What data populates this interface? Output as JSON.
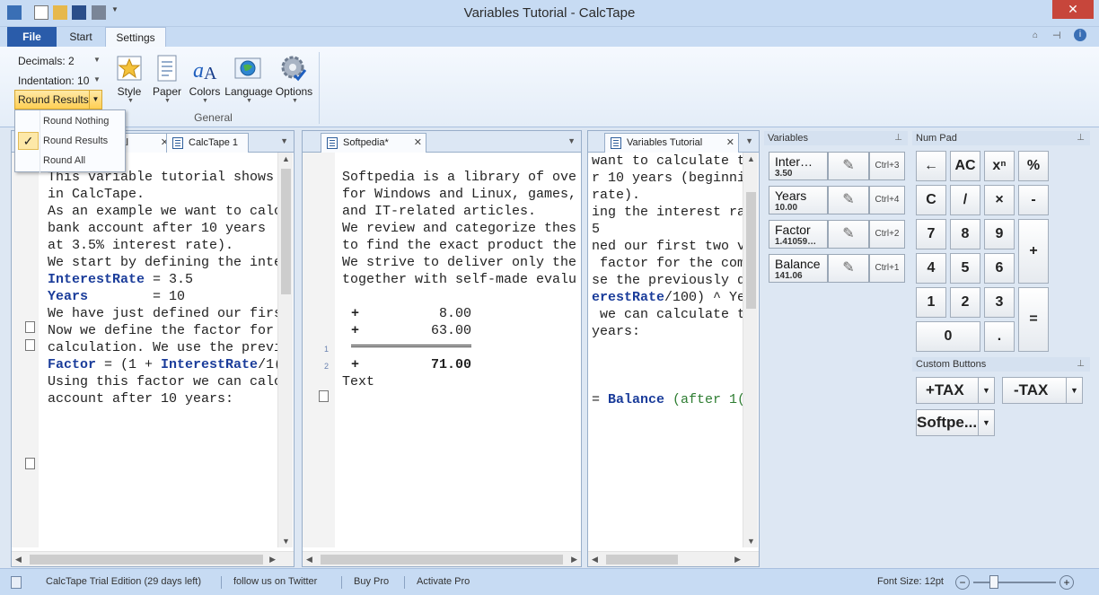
{
  "window": {
    "title": "Variables Tutorial - CalcTape",
    "close_glyph": "✕"
  },
  "ribbon": {
    "tabs": {
      "file": "File",
      "start": "Start",
      "settings": "Settings"
    },
    "decimals": "Decimals: 2",
    "indentation": "Indentation: 10",
    "round_button": "Round Results",
    "buttons": {
      "style": "Style",
      "paper": "Paper",
      "colors": "Colors",
      "language": "Language",
      "options": "Options"
    },
    "group_label": "General"
  },
  "round_menu": {
    "items": [
      "Round Nothing",
      "Round Results",
      "Round All"
    ],
    "checked": "Round Results",
    "check_glyph": "✓"
  },
  "pane1": {
    "tabs": [
      "ial",
      "CalcTape 1"
    ],
    "lines": [
      "This variable tutorial shows",
      "in CalcTape.",
      "",
      "As an example we want to calc",
      "bank account after 10 years",
      "at 3.5% interest rate).",
      "",
      "We start by defining the inte",
      "",
      "",
      "",
      "We have just defined our firs",
      "",
      "Now we define the factor for",
      "calculation. We use the previ",
      "",
      "",
      "",
      "Using this factor we can calc",
      "account after 10 years:"
    ],
    "var1_name": "InterestRate",
    "var1_value": " = 3.5",
    "var2_name": "Years",
    "var2_value": "        = 10",
    "factor_name": "Factor",
    "factor_eq": " = (1 + ",
    "factor_var": "InterestRate",
    "factor_tail": "/1("
  },
  "pane2": {
    "tab": "Softpedia*",
    "lines": [
      "Softpedia is a library of ove",
      "for Windows and Linux, games,",
      "and IT-related articles.",
      "",
      "We review and categorize thes",
      "to find the exact product the",
      "",
      "We strive to deliver only the",
      "together with self-made evalu"
    ],
    "calc": [
      {
        "num": "1",
        "op": "+",
        "value": "8.00"
      },
      {
        "num": "2",
        "op": "+",
        "value": "63.00"
      }
    ],
    "total_op": "+",
    "total": "71.00",
    "after": "Text"
  },
  "pane3": {
    "tab": "Variables Tutorial",
    "lines": [
      "want to calculate t",
      "r 10 years (beginni",
      "rate).",
      "",
      "ing the interest ra",
      "",
      "5",
      "",
      "",
      "ned our first two v",
      "",
      "",
      " factor for the com",
      "se the previously d",
      "",
      "",
      "",
      " we can calculate t",
      "years:"
    ],
    "formula_var": "erestRate",
    "formula_tail": "/100) ^ Ye",
    "balance_eq": "= ",
    "balance_name": "Balance",
    "balance_note": " (after 1("
  },
  "variables": {
    "header": "Variables",
    "items": [
      {
        "name": "Inter…",
        "value": "3.50",
        "shortcut": "Ctrl+3"
      },
      {
        "name": "Years",
        "value": "10.00",
        "shortcut": "Ctrl+4"
      },
      {
        "name": "Factor",
        "value": "1.41059…",
        "shortcut": "Ctrl+2"
      },
      {
        "name": "Balance",
        "value": "141.06",
        "shortcut": "Ctrl+1"
      }
    ],
    "edit_glyph": "✎"
  },
  "numpad": {
    "header": "Num Pad",
    "keys": {
      "back": "←",
      "ac": "AC",
      "pow": "xⁿ",
      "pct": "%",
      "c": "C",
      "div": "/",
      "mul": "×",
      "minus": "-",
      "k7": "7",
      "k8": "8",
      "k9": "9",
      "plus": "+",
      "k4": "4",
      "k5": "5",
      "k6": "6",
      "k1": "1",
      "k2": "2",
      "k3": "3",
      "eq": "=",
      "k0": "0",
      "dot": "."
    }
  },
  "custom_buttons": {
    "header": "Custom Buttons",
    "items": [
      "+TAX",
      "-TAX",
      "Softpe..."
    ]
  },
  "status": {
    "trial": "CalcTape Trial Edition (29 days left)",
    "twitter": "follow us on Twitter",
    "buy": "Buy Pro",
    "activate": "Activate Pro",
    "font_size": "Font Size: 12pt",
    "zoom_out": "−",
    "zoom_in": "+"
  },
  "colors": {
    "accent": "#2a5caa",
    "keyword": "#1a3c9a",
    "highlight": "#ffcf55"
  }
}
